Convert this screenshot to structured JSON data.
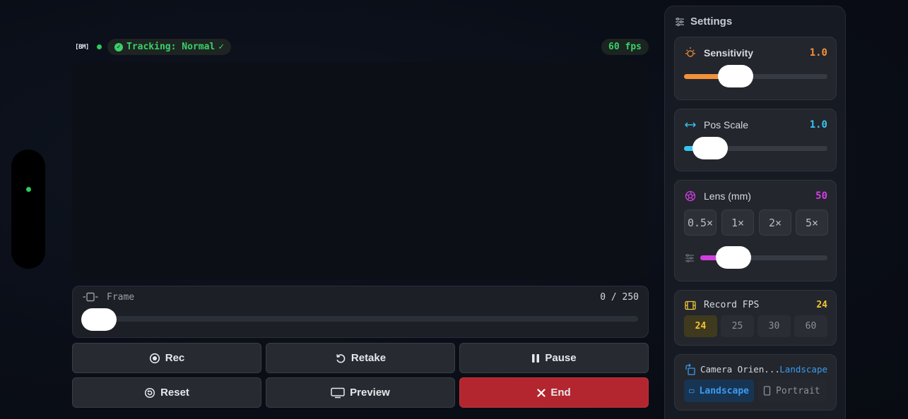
{
  "status": {
    "logo": "[BM]",
    "tracking_text": "Tracking: Normal",
    "tracking_check": "✓",
    "fps_badge": "60 fps"
  },
  "frame": {
    "label": "Frame",
    "current": 0,
    "total": 250,
    "counter": "0 / 250",
    "progress": 0
  },
  "controls": {
    "rec": "Rec",
    "retake": "Retake",
    "pause": "Pause",
    "reset": "Reset",
    "preview": "Preview",
    "end": "End"
  },
  "settings": {
    "title": "Settings",
    "sensitivity": {
      "label": "Sensitivity",
      "value": "1.0",
      "fraction": 0.36,
      "color": "#f3913a"
    },
    "pos_scale": {
      "label": "Pos Scale",
      "value": "1.0",
      "fraction": 0.18,
      "color": "#38c4ef"
    },
    "lens": {
      "label": "Lens (mm)",
      "value": "50",
      "color": "#cf3fe0",
      "presets": [
        "0.5×",
        "1×",
        "2×",
        "5×"
      ],
      "fraction": 0.26
    },
    "record_fps": {
      "label": "Record FPS",
      "value": "24",
      "color": "#f2c531",
      "options": [
        "24",
        "25",
        "30",
        "60"
      ],
      "selected": "24"
    },
    "orientation": {
      "label": "Camera Orien...",
      "value": "Landscape",
      "color": "#3b9bf0",
      "options": [
        "Landscape",
        "Portrait"
      ],
      "selected": "Landscape"
    }
  }
}
